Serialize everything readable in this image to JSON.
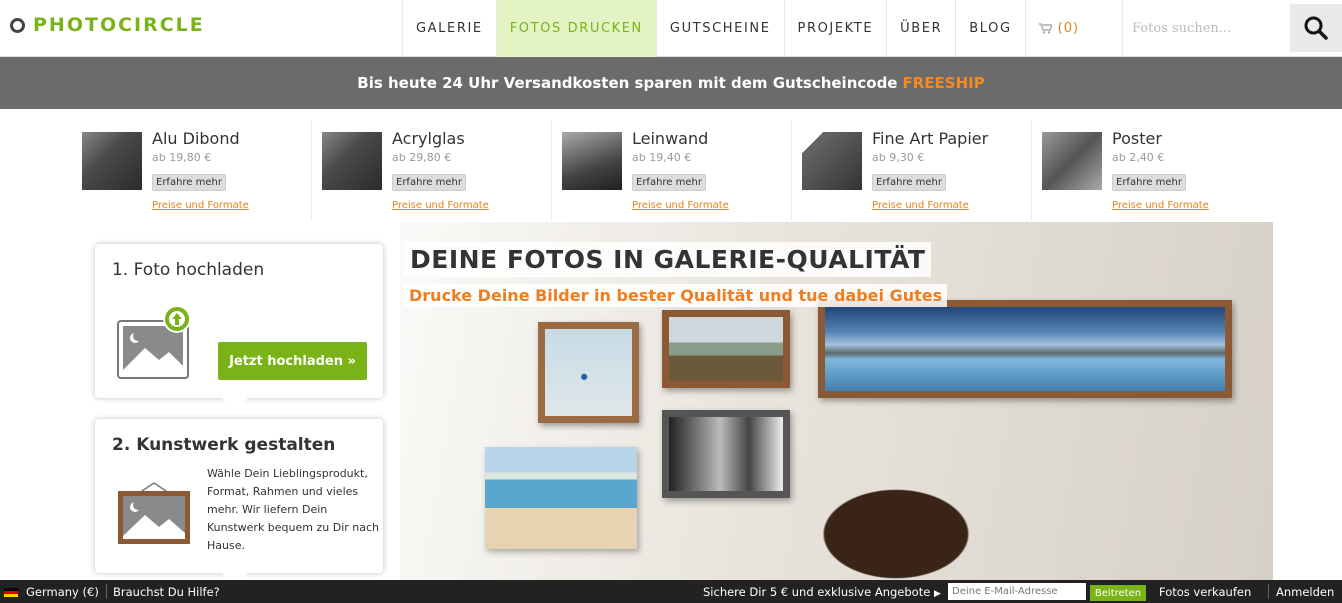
{
  "header": {
    "logo": "PHOTOCIRCLE",
    "nav": [
      {
        "label": "GALERIE"
      },
      {
        "label": "FOTOS DRUCKEN"
      },
      {
        "label": "GUTSCHEINE"
      },
      {
        "label": "PROJEKTE"
      },
      {
        "label": "ÜBER"
      },
      {
        "label": "BLOG"
      }
    ],
    "cart_count": "(0)",
    "search_placeholder": "Fotos suchen..."
  },
  "promo": {
    "text": "Bis heute 24 Uhr Versandkosten sparen mit dem Gutscheincode",
    "code": "FREESHIP"
  },
  "products": [
    {
      "name": "Alu Dibond",
      "price": "ab 19,80 €",
      "more": "Erfahre mehr",
      "link": "Preise und Formate"
    },
    {
      "name": "Acrylglas",
      "price": "ab 29,80 €",
      "more": "Erfahre mehr",
      "link": "Preise und Formate"
    },
    {
      "name": "Leinwand",
      "price": "ab 19,40 €",
      "more": "Erfahre mehr",
      "link": "Preise und Formate"
    },
    {
      "name": "Fine Art Papier",
      "price": "ab 9,30 €",
      "more": "Erfahre mehr",
      "link": "Preise und Formate"
    },
    {
      "name": "Poster",
      "price": "ab 2,40 €",
      "more": "Erfahre mehr",
      "link": "Preise und Formate"
    }
  ],
  "hero": {
    "title": "DEINE FOTOS IN GALERIE-QUALITÄT",
    "subtitle": "Drucke Deine Bilder in bester Qualität und tue dabei Gutes"
  },
  "steps": {
    "step1": {
      "title": "1. Foto hochladen",
      "button": "Jetzt hochladen »"
    },
    "step2": {
      "title": "2. Kunstwerk gestalten",
      "text": "Wähle Dein Lieblingsprodukt, Format, Rahmen und vieles mehr. Wir liefern Dein Kunstwerk bequem zu Dir nach Hause."
    }
  },
  "footer": {
    "country": "Germany (€)",
    "help": "Brauchst Du Hilfe?",
    "offer": "Sichere Dir 5 € und exklusive Angebote",
    "email_placeholder": "Deine E-Mail-Adresse",
    "join": "Beitreten",
    "sell": "Fotos verkaufen",
    "login": "Anmelden"
  },
  "colors": {
    "brand_green": "#7ab317",
    "accent_orange": "#f07d1e"
  }
}
